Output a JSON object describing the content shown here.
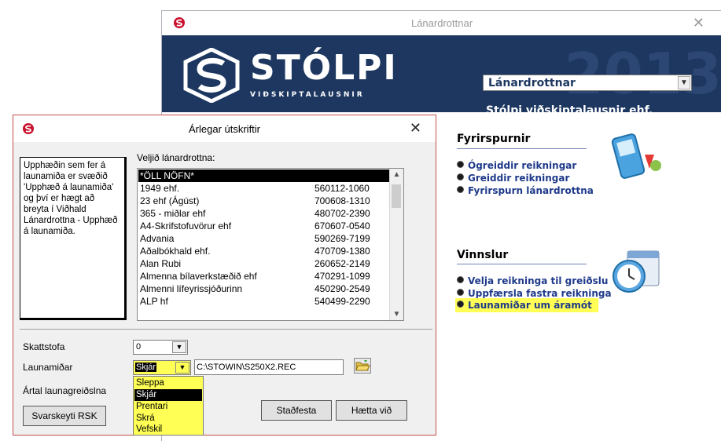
{
  "main_window": {
    "title": "Lánardrottnar",
    "close_glyph": "✕",
    "brand": "STÓLPI",
    "brand_sub": "VIÐSKIPTALAUSNIR",
    "year_watermark": "2013",
    "selector_value": "Lánardrottnar",
    "company": "Stólpi viðskiptalausnir ehf."
  },
  "fyrirspurnir": {
    "title": "Fyrirspurnir",
    "items": [
      "Ógreiddir reikningar",
      "Greiddir reikningar",
      "Fyrirspurn lánardrottna"
    ]
  },
  "vinnslur": {
    "title": "Vinnslur",
    "items": [
      "Velja reikninga til greiðslu",
      "Uppfærsla fastra reikninga",
      "Launamiðar um áramót"
    ]
  },
  "dialog": {
    "title": "Árlegar útskriftir",
    "close_glyph": "✕",
    "info_text": "Upphæðin sem fer á launamiða er svæðið 'Upphæð á launamiða' og því er hægt að breyta í Viðhald Lánardrottna - Upphæð á launamiða.",
    "list_label": "Veljið lánardrottna:",
    "rows": [
      {
        "name": "*ÖLL NÖFN*",
        "kt": ""
      },
      {
        "name": "1949 ehf.",
        "kt": "560112-1060"
      },
      {
        "name": "23 ehf  (Ágúst)",
        "kt": "700608-1310"
      },
      {
        "name": "365 - miðlar ehf",
        "kt": "480702-2390"
      },
      {
        "name": "A4-Skrifstofuvörur ehf",
        "kt": "670607-0540"
      },
      {
        "name": "Advania",
        "kt": "590269-7199"
      },
      {
        "name": "Aðalbókhald ehf.",
        "kt": "470709-1380"
      },
      {
        "name": "Alan Rubi",
        "kt": "260652-2149"
      },
      {
        "name": "Almenna bílaverkstæðið ehf",
        "kt": "470291-1099"
      },
      {
        "name": "Almenni lífeyrissjóðurinn",
        "kt": "450290-2549"
      },
      {
        "name": "ALP hf",
        "kt": "540499-2290"
      }
    ],
    "skattstofa_label": "Skattstofa",
    "skattstofa_value": "0",
    "launamidar_label": "Launamiðar",
    "launamidar_value": "Skjár",
    "path_value": "C:\\STOWIN\\S250X2.REC",
    "artal_label": "Ártal launagreiðslna",
    "options": [
      "Sleppa",
      "Skjár",
      "Prentari",
      "Skrá",
      "Vefskil"
    ],
    "selected_option": "Skjár",
    "btn_rsk": "Svarskeyti RSK",
    "btn_confirm": "Staðfesta",
    "btn_cancel": "Hætta við"
  }
}
